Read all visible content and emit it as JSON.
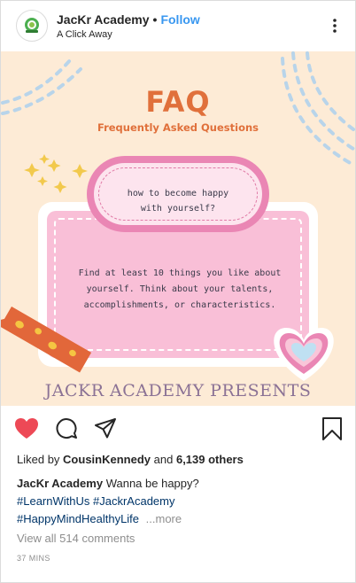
{
  "header": {
    "username": "JacKr Academy",
    "separator": "•",
    "follow_label": "Follow",
    "location": "A Click Away",
    "avatar_icon": "academy-logo-icon",
    "menu_icon": "more-vertical-icon"
  },
  "post": {
    "title": "FAQ",
    "subtitle": "Frequently Asked Questions",
    "question_line1": "how to become happy",
    "question_line2": "with yourself?",
    "answer_line1": "Find at least 10 things you like about",
    "answer_line2": "yourself. Think about your talents,",
    "answer_line3": "accomplishments, or characteristics.",
    "presents": "JACKR ACADEMY PRESENTS"
  },
  "actions": {
    "like_icon": "heart-filled-icon",
    "comment_icon": "comment-icon",
    "share_icon": "paper-plane-icon",
    "save_icon": "bookmark-icon",
    "liked": true,
    "like_color": "#ed4956"
  },
  "likes": {
    "prefix": "Liked by",
    "user": "CousinKennedy",
    "conjunction": "and",
    "others": "6,139 others"
  },
  "caption": {
    "username": "JacKr Academy",
    "text": "Wanna be happy?",
    "hashtags": [
      "#LearnWithUs",
      "#JackrAcademy",
      "#HappyMindHealthyLife"
    ],
    "more_label": "...more"
  },
  "comments": {
    "view_all": "View all 514 comments"
  },
  "timestamp": "37 MINS",
  "colors": {
    "follow": "#3897f0",
    "hashtag": "#003569",
    "muted": "#8e8e8e",
    "post_bg": "#fdebd6",
    "accent_orange": "#e0703b",
    "accent_pink": "#ea86b4"
  }
}
